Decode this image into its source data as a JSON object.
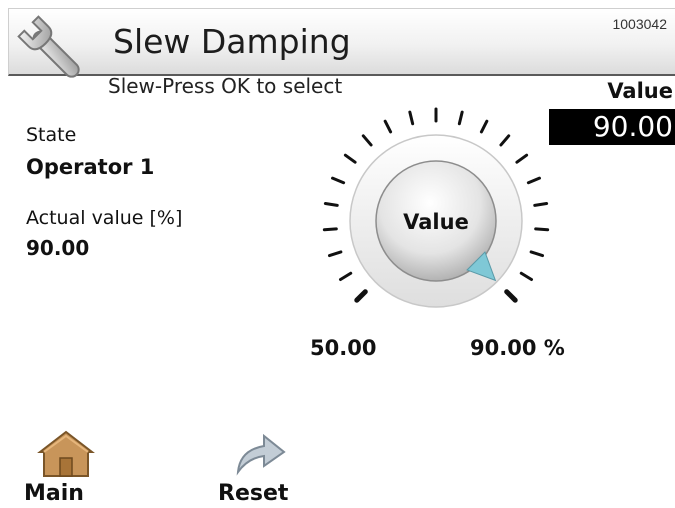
{
  "header": {
    "title": "Slew Damping",
    "screen_id": "1003042"
  },
  "hint": "Slew-Press OK to select",
  "value_panel": {
    "label": "Value",
    "value": "90.00"
  },
  "state": {
    "label": "State",
    "value": "Operator 1"
  },
  "actual": {
    "label": "Actual value [%]",
    "value": "90.00"
  },
  "dial": {
    "knob_label": "Value",
    "min_label": "50.00",
    "max_label": "90.00 %",
    "min": 50,
    "max": 90,
    "current": 90
  },
  "nav": {
    "main_label": "Main",
    "reset_label": "Reset"
  },
  "icons": {
    "title_icon": "wrench-icon",
    "main_icon": "home-icon",
    "reset_icon": "undo-arrow-icon"
  },
  "colors": {
    "value_box_bg": "#000000",
    "pointer": "#7fc8d6",
    "house": "#c8955a"
  }
}
